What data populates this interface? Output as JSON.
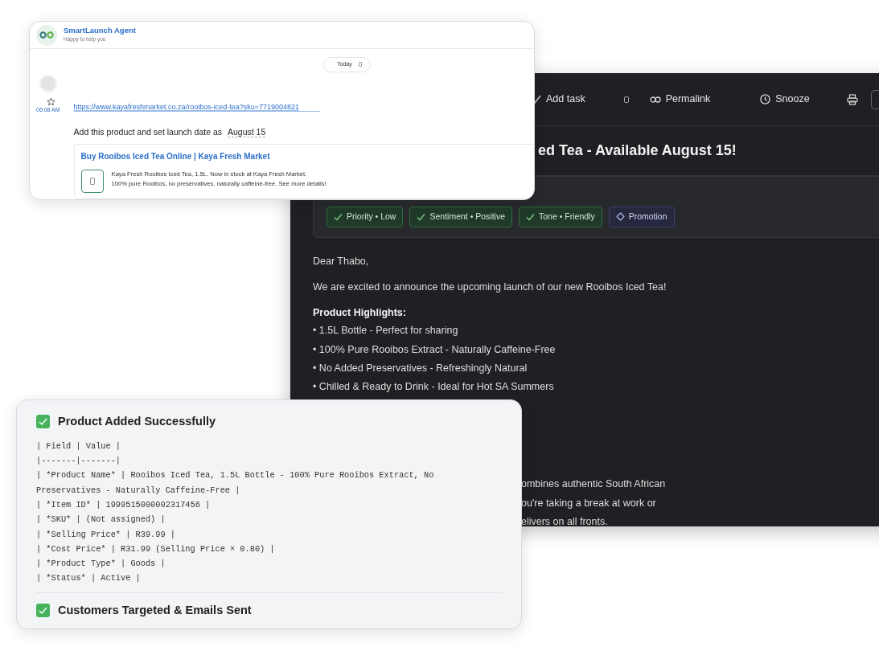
{
  "chat": {
    "agent_name": "SmartLaunch Agent",
    "agent_status": "Happy to help you",
    "date_chip": "Today",
    "messages": [
      {
        "starred": false,
        "time": "06:08 AM",
        "link": "https://www.kayafreshmarket.co.za/rooibos-iced-tea?sku=7719004821",
        "text": "Add this product and set launch date as",
        "date_value": "August 15",
        "preview": {
          "title": "Buy Rooibos Iced Tea Online | Kaya Fresh Market",
          "lines": [
            "Kaya Fresh Rooibos Iced Tea, 1.5L. Now in stock at Kaya Fresh Market.",
            "100% pure Rooibos, no preservatives, naturally caffeine-free. See more details!"
          ]
        }
      }
    ]
  },
  "email": {
    "toolbar": [
      {
        "kind": "check",
        "label": "Add task"
      },
      {
        "kind": "blank"
      },
      {
        "kind": "link",
        "label": "Permalink"
      },
      {
        "kind": "clock",
        "label": "Snooze"
      },
      {
        "kind": "printer"
      },
      {
        "kind": "more"
      }
    ],
    "subject": "ed Tea - Available August 15!",
    "tags": [
      {
        "kind": "status",
        "label": "Priority • Low"
      },
      {
        "kind": "status",
        "label": "Sentiment • Positive"
      },
      {
        "kind": "status",
        "label": "Tone • Friendly"
      },
      {
        "kind": "category",
        "label": "Promotion"
      }
    ],
    "greeting": "Dear Thabo,",
    "intro": "We are excited to announce the upcoming launch of our new Rooibos Iced Tea!",
    "highlights_title": "Product Highlights:",
    "highlights": [
      "• 1.5L Bottle - Perfect for sharing",
      "• 100% Pure Rooibos Extract - Naturally Caffeine-Free",
      "• No Added Preservatives - Refreshingly Natural",
      "• Chilled & Ready to Drink - Ideal for Hot SA Summers"
    ],
    "partial_lines": [
      "ombines authentic South African",
      "ou're taking a break at work or",
      "elivers on all fronts."
    ]
  },
  "results": [
    {
      "title": "Product Added Successfully",
      "done": true,
      "lines": [
        "| Field | Value |",
        "|-------|-------|",
        "| *Product Name* | Rooibos Iced Tea, 1.5L Bottle - 100% Pure Rooibos Extract, No Preservatives - Naturally Caffeine-Free |",
        "| *Item ID* | 1999515000002317456 |",
        "| *SKU* | (Not assigned) |",
        "| *Selling Price* | R39.99 |",
        "| *Cost Price* | R31.99 (Selling Price × 0.80) |",
        "| *Product Type* | Goods |",
        "| *Status* | Active |"
      ]
    },
    {
      "title": "Customers Targeted & Emails Sent",
      "done": true
    }
  ]
}
